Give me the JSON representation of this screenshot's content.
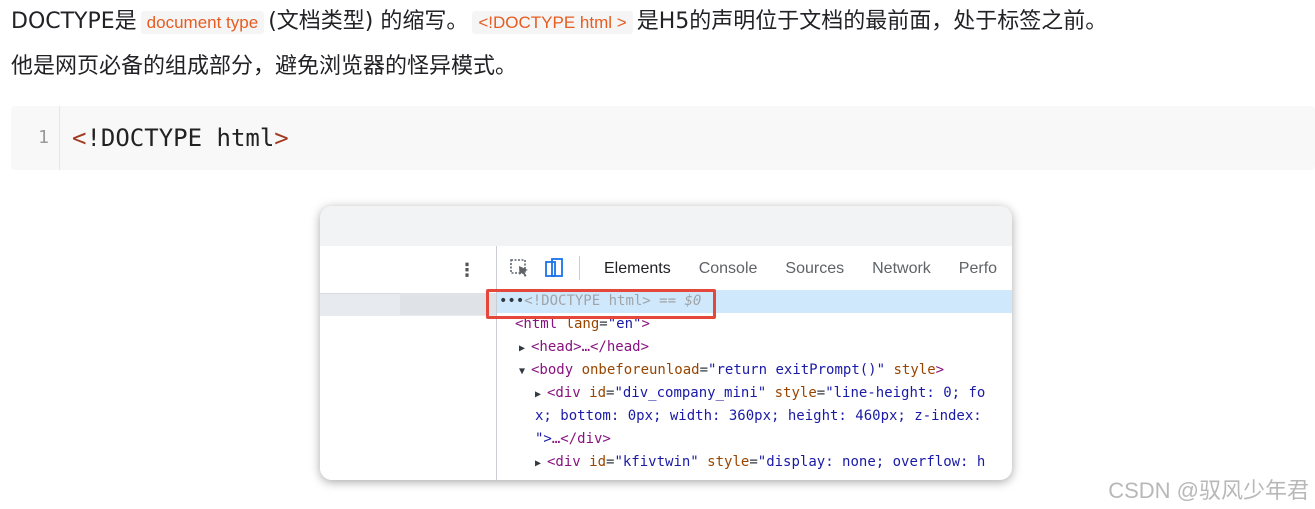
{
  "article": {
    "p1_a": "DOCTYPE是",
    "p1_code1": "document type",
    "p1_b": "(文档类型) 的缩写。",
    "p1_code2": "<!DOCTYPE html >",
    "p1_c": "是H5的声明位于文档的最前面，处于标签之前。",
    "p2": "他是网页必备的组成部分，避免浏览器的怪异模式。"
  },
  "code_block": {
    "line_number": "1",
    "lt": "<",
    "text": "!DOCTYPE html",
    "gt": ">"
  },
  "devtools": {
    "tabs": [
      "Elements",
      "Console",
      "Sources",
      "Network",
      "Perfo"
    ],
    "active_tab": "Elements",
    "rows": {
      "r1_dots": "•••",
      "r1_doctype": "<!DOCTYPE html>",
      "r1_eq": " == $0",
      "r2_open": "<html ",
      "r2_attr": "lang",
      "r2_eq": "=",
      "r2_val": "\"en\"",
      "r2_close": ">",
      "r3": "<head>…</head>",
      "r4_open": "<body ",
      "r4_attr1": "onbeforeunload",
      "r4_val1": "\"return exitPrompt()\"",
      "r4_attr2": " style",
      "r4_close": ">",
      "r5_open": "<div ",
      "r5_attr1": "id",
      "r5_val1": "\"div_company_mini\"",
      "r5_attr2": " style",
      "r5_val2": "\"line-height: 0; fo",
      "r6_val": "x; bottom: 0px; width: 360px; height: 460px; z-index:",
      "r7_val": "\">",
      "r7_tag": "…</div>",
      "r8_open": "<div ",
      "r8_attr1": "id",
      "r8_val1": "\"kfivtwin\"",
      "r8_attr2": " style",
      "r8_val2": "\"display: none; overflow: h"
    }
  },
  "watermark": "CSDN @驭风少年君",
  "colors": {
    "inline_code_text": "#e65c21",
    "highlight_box": "#e5473a",
    "active_tab_underline": "#1a73e8",
    "selected_row": "#cfe8fc"
  }
}
